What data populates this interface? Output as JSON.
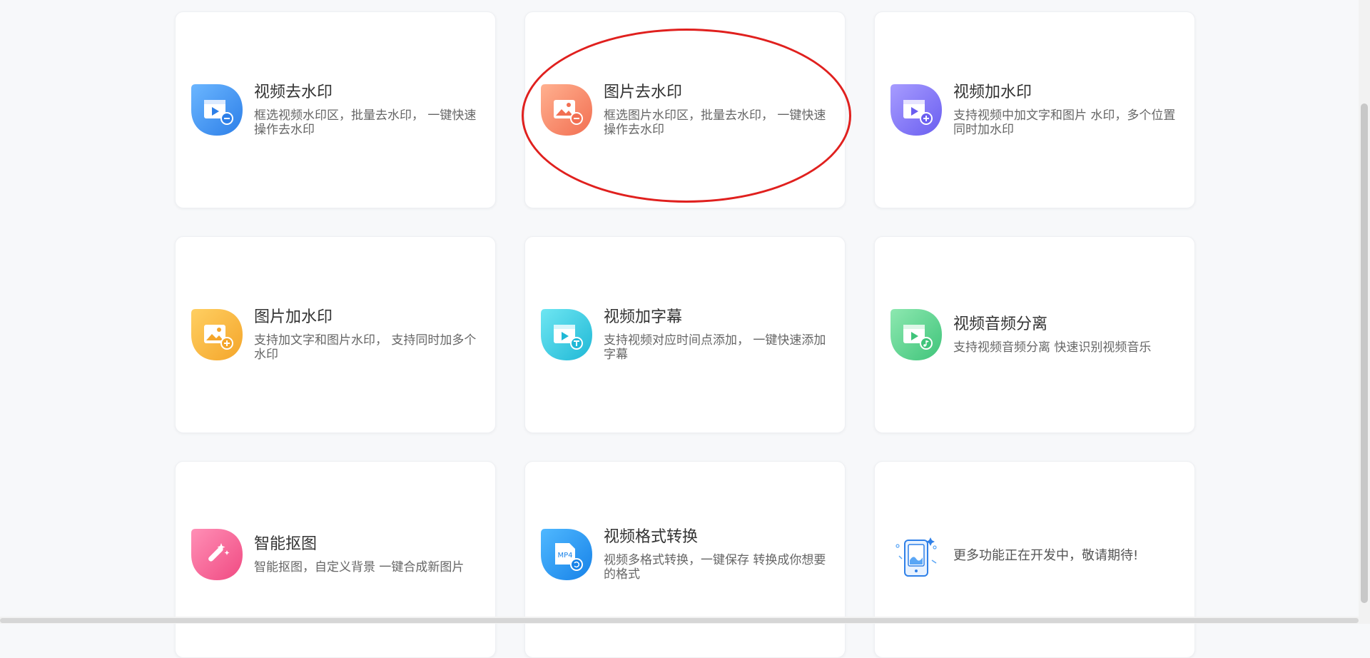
{
  "tools": [
    {
      "title": "视频去水印",
      "desc": "框选视频水印区，批量去水印， 一键快速操作去水印",
      "icon": "video-remove-watermark-icon"
    },
    {
      "title": "图片去水印",
      "desc": "框选图片水印区，批量去水印， 一键快速操作去水印",
      "icon": "image-remove-watermark-icon"
    },
    {
      "title": "视频加水印",
      "desc": "支持视频中加文字和图片 水印，多个位置同时加水印",
      "icon": "video-add-watermark-icon"
    },
    {
      "title": "图片加水印",
      "desc": "支持加文字和图片水印， 支持同时加多个水印",
      "icon": "image-add-watermark-icon"
    },
    {
      "title": "视频加字幕",
      "desc": "支持视频对应时间点添加， 一键快速添加字幕",
      "icon": "video-add-subtitle-icon"
    },
    {
      "title": "视频音频分离",
      "desc": "支持视频音频分离 快速识别视频音乐",
      "icon": "video-audio-separate-icon"
    },
    {
      "title": "智能抠图",
      "desc": "智能抠图，自定义背景 一键合成新图片",
      "icon": "smart-cutout-icon"
    },
    {
      "title": "视频格式转换",
      "desc": "视频多格式转换，一键保存 转换成你想要的格式",
      "icon": "video-format-convert-icon",
      "icon_label": "MP4"
    }
  ],
  "more": {
    "text": "更多功能正在开发中，敬请期待!",
    "icon": "coming-soon-illustration-icon"
  },
  "colors": {
    "blue": "#3d8ef0",
    "orange": "#f6866a",
    "purple": "#7b6ef0",
    "yellow": "#f7b23b",
    "cyan": "#2fc9e0",
    "green": "#58d38a",
    "pink": "#f45a8d",
    "deepblue": "#2592f0",
    "highlight": "#e0201e"
  }
}
